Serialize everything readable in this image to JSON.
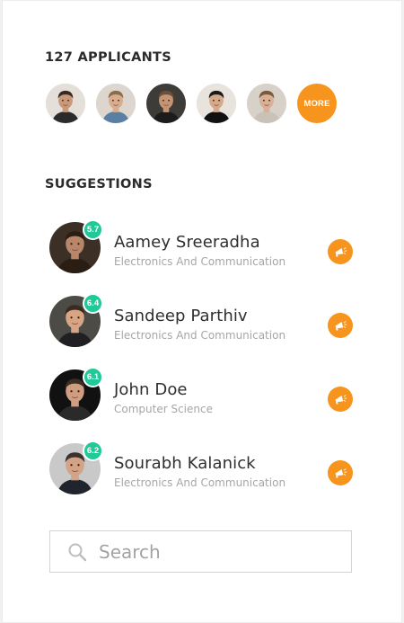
{
  "applicants": {
    "title": "127 APPLICANTS",
    "more_label": "MORE",
    "avatars": [
      {
        "name": "applicant-avatar-1",
        "skin": "#c99a7a",
        "hair": "#3a2a20",
        "bg": "#e5dfd9",
        "shirt": "#2b2b2b"
      },
      {
        "name": "applicant-avatar-2",
        "skin": "#d8ad8f",
        "hair": "#8a6b4a",
        "bg": "#dcd6ce",
        "shirt": "#5b7ea3"
      },
      {
        "name": "applicant-avatar-3",
        "skin": "#c49473",
        "hair": "#6b5137",
        "bg": "#3d3c38",
        "shirt": "#1c1c1c"
      },
      {
        "name": "applicant-avatar-4",
        "skin": "#d6a98b",
        "hair": "#1d1a1a",
        "bg": "#e8e3dc",
        "shirt": "#111111"
      },
      {
        "name": "applicant-avatar-5",
        "skin": "#d8b095",
        "hair": "#7a5a3b",
        "bg": "#d7d1c9",
        "shirt": "#c9c2b8"
      }
    ]
  },
  "suggestions": {
    "title": "SUGGESTIONS",
    "items": [
      {
        "name": "Aamey Sreeradha",
        "department": "Electronics And Communication",
        "score": "5.7",
        "skin": "#b8876a",
        "hair": "#2a1d14",
        "bg": "#3b2f26",
        "shirt": "#2a1d14"
      },
      {
        "name": "Sandeep Parthiv",
        "department": "Electronics And Communication",
        "score": "6.4",
        "skin": "#d7a584",
        "hair": "#3a2b20",
        "bg": "#4d4b46",
        "shirt": "#1f1f24"
      },
      {
        "name": "John Doe",
        "department": "Computer Science",
        "score": "6.1",
        "skin": "#cf9e80",
        "hair": "#3b2e24",
        "bg": "#111111",
        "shirt": "#2a2a2a"
      },
      {
        "name": "Sourabh Kalanick",
        "department": "Electronics And Communication",
        "score": "6.2",
        "skin": "#d3a386",
        "hair": "#3c332c",
        "bg": "#c9c9c9",
        "shirt": "#20242c"
      }
    ]
  },
  "search": {
    "placeholder": "Search"
  },
  "colors": {
    "accent": "#f7941d",
    "score": "#20c997"
  },
  "icons": {
    "action": "megaphone-icon",
    "search": "search-icon"
  }
}
